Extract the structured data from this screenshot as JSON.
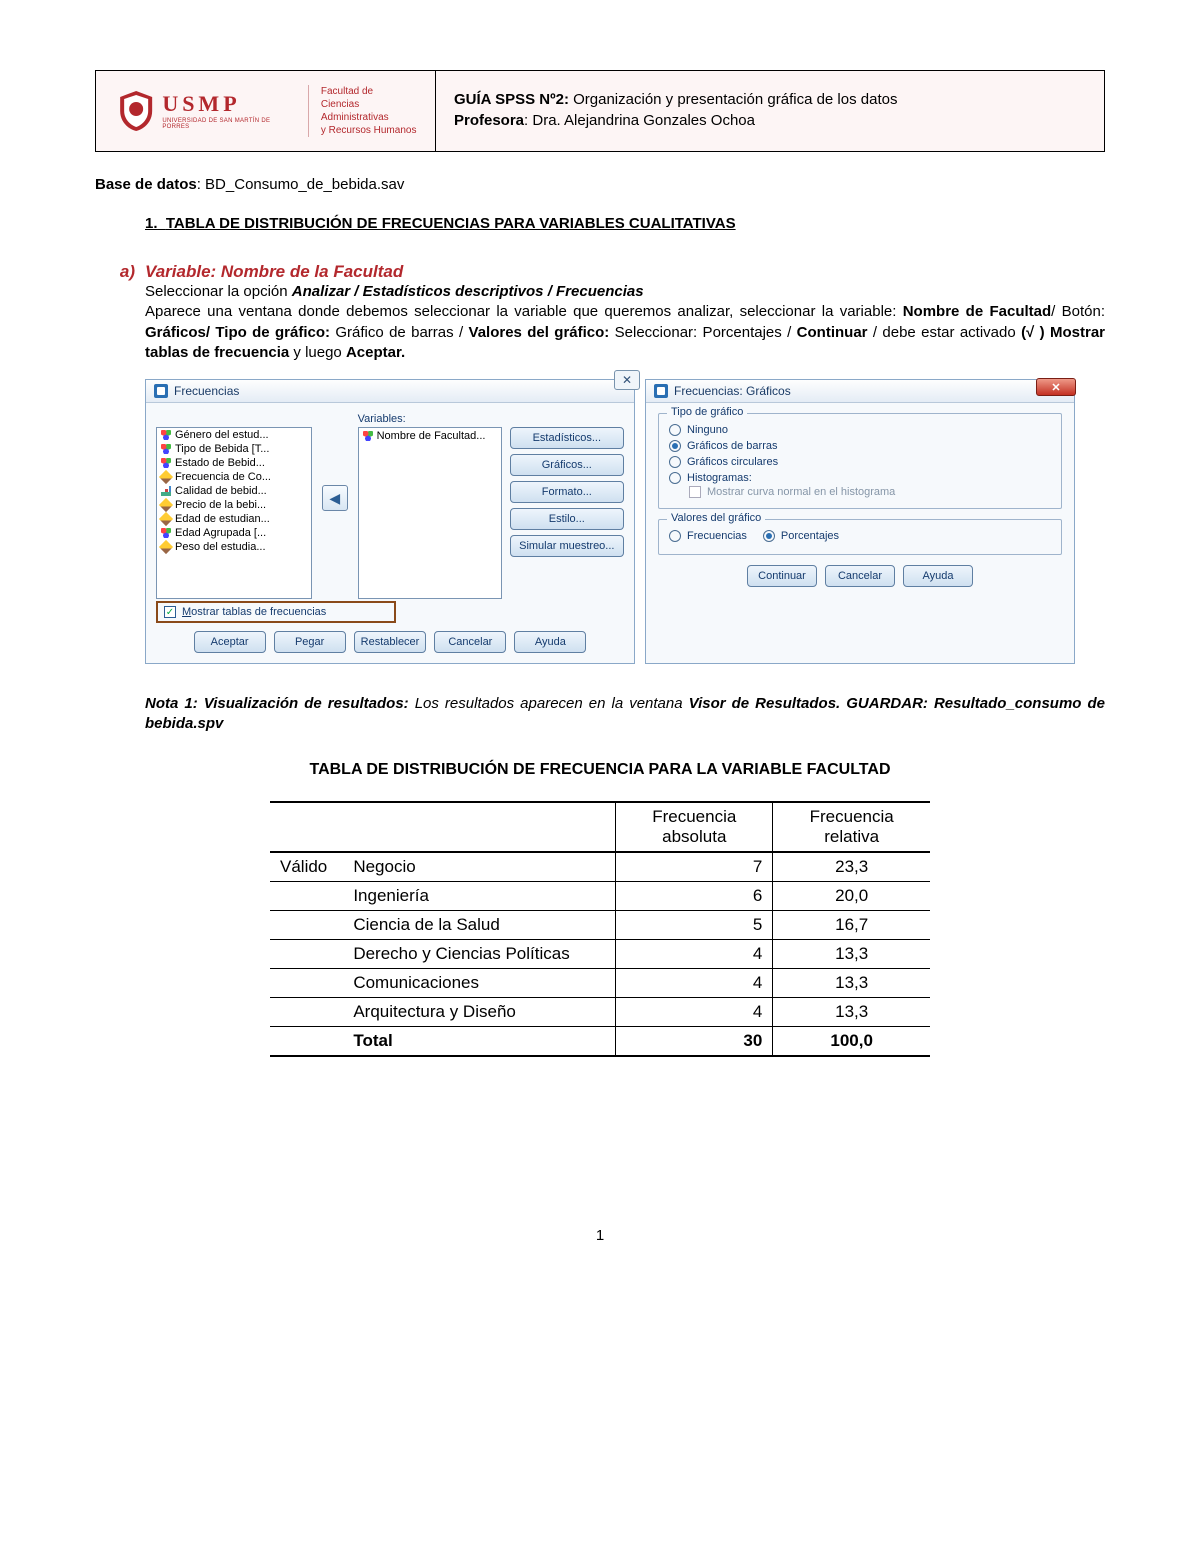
{
  "header": {
    "logo_name": "USMP",
    "logo_sub": "UNIVERSIDAD DE SAN MARTÍN DE PORRES",
    "fac1": "Facultad de",
    "fac2": "Ciencias Administrativas",
    "fac3": "y Recursos Humanos",
    "guide_bold": "GUÍA SPSS Nº2:",
    "guide_rest": " Organización y presentación gráfica de los datos",
    "prof_bold": "Profesora",
    "prof_rest": ": Dra. Alejandrina Gonzales Ochoa"
  },
  "db_label": "Base de datos",
  "db_value": ": BD_Consumo_de_bebida.sav",
  "heading_num": "1.",
  "heading_text": "TABLA DE DISTRIBUCIÓN DE FRECUENCIAS PARA VARIABLES CUALITATIVAS",
  "section": {
    "letter": "a)",
    "title": "Variable: Nombre de la Facultad",
    "line1_a": "Seleccionar la opción ",
    "line1_b": "Analizar / Estadísticos descriptivos / Frecuencias",
    "line2_a": "Aparece una ventana donde debemos seleccionar la variable que queremos analizar, seleccionar la variable: ",
    "line2_b": "Nombre de Facultad",
    "line2_c": "/ Botón: ",
    "line2_d": "Gráficos/ Tipo de gráfico:",
    "line2_e": " Gráfico de barras / ",
    "line2_f": "Valores del gráfico:",
    "line2_g": "  Seleccionar: Porcentajes / ",
    "line2_h": "Continuar",
    "line2_i": " / debe estar activado ",
    "line2_j": "(√ ) Mostrar tablas de frecuencia",
    "line2_k": "  y luego ",
    "line2_l": "Aceptar."
  },
  "spss": {
    "panel1_title": "Frecuencias",
    "vars_label": "Variables:",
    "list": [
      {
        "icon": "dot3",
        "text": "Género del estud..."
      },
      {
        "icon": "dot3",
        "text": "Tipo de Bebida [T..."
      },
      {
        "icon": "dot3",
        "text": "Estado de Bebid..."
      },
      {
        "icon": "pencil",
        "text": "Frecuencia de Co..."
      },
      {
        "icon": "bars",
        "text": "Calidad de bebid..."
      },
      {
        "icon": "pencil",
        "text": "Precio de la bebi..."
      },
      {
        "icon": "pencil",
        "text": "Edad de estudian..."
      },
      {
        "icon": "dot3",
        "text": "Edad Agrupada [..."
      },
      {
        "icon": "pencil",
        "text": "Peso del estudia..."
      }
    ],
    "selected_var": "Nombre de Facultad...",
    "btns": [
      "Estadísticos...",
      "Gráficos...",
      "Formato...",
      "Estilo...",
      "Simular muestreo..."
    ],
    "check_label": "Mostrar tablas de frecuencias",
    "bottom": [
      "Aceptar",
      "Pegar",
      "Restablecer",
      "Cancelar",
      "Ayuda"
    ],
    "panel2_title": "Frecuencias: Gráficos",
    "group1_legend": "Tipo de gráfico",
    "group1": [
      {
        "label": "Ninguno",
        "sel": false
      },
      {
        "label": "Gráficos de barras",
        "sel": true
      },
      {
        "label": "Gráficos circulares",
        "sel": false
      },
      {
        "label": "Histogramas:",
        "sel": false
      }
    ],
    "hist_sub": "Mostrar curva normal en el histograma",
    "group2_legend": "Valores del gráfico",
    "group2": [
      {
        "label": "Frecuencias",
        "sel": false
      },
      {
        "label": "Porcentajes",
        "sel": true
      }
    ],
    "p2_bottom": [
      "Continuar",
      "Cancelar",
      "Ayuda"
    ]
  },
  "nota": {
    "lead": "Nota 1: Visualización de resultados:",
    "body1": " Los resultados aparecen en la ventana ",
    "body2": "Visor de Resultados. GUARDAR: Resultado_consumo de bebida.spv"
  },
  "table_title": "TABLA DE DISTRIBUCIÓN DE FRECUENCIA PARA LA VARIABLE FACULTAD",
  "table": {
    "col1a": "Frecuencia",
    "col1b": "absoluta",
    "col2a": "Frecuencia",
    "col2b": "relativa",
    "valido": "Válido",
    "rows": [
      {
        "cat": "Negocio",
        "fa": "7",
        "fr": "23,3"
      },
      {
        "cat": "Ingeniería",
        "fa": "6",
        "fr": "20,0"
      },
      {
        "cat": "Ciencia de la Salud",
        "fa": "5",
        "fr": "16,7"
      },
      {
        "cat": "Derecho y Ciencias Políticas",
        "fa": "4",
        "fr": "13,3"
      },
      {
        "cat": "Comunicaciones",
        "fa": "4",
        "fr": "13,3"
      },
      {
        "cat": "Arquitectura y Diseño",
        "fa": "4",
        "fr": "13,3"
      }
    ],
    "total_label": "Total",
    "total_fa": "30",
    "total_fr": "100,0"
  },
  "pagenum": "1",
  "chart_data": {
    "type": "table",
    "title": "TABLA DE DISTRIBUCIÓN DE FRECUENCIA PARA LA VARIABLE FACULTAD",
    "categories": [
      "Negocio",
      "Ingeniería",
      "Ciencia de la Salud",
      "Derecho y Ciencias Políticas",
      "Comunicaciones",
      "Arquitectura y Diseño"
    ],
    "series": [
      {
        "name": "Frecuencia absoluta",
        "values": [
          7,
          6,
          5,
          4,
          4,
          4
        ]
      },
      {
        "name": "Frecuencia relativa",
        "values": [
          23.3,
          20.0,
          16.7,
          13.3,
          13.3,
          13.3
        ]
      }
    ],
    "total": {
      "Frecuencia absoluta": 30,
      "Frecuencia relativa": 100.0
    }
  }
}
